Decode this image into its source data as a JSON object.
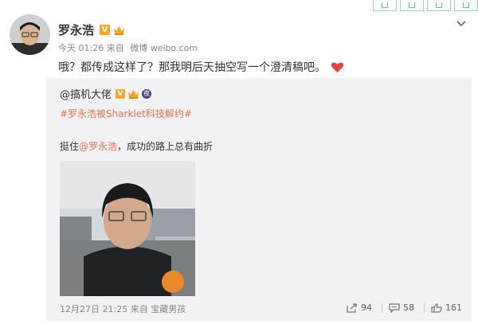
{
  "colors": {
    "accent": "#eb7350",
    "verified": "#f5a623",
    "heart": "#e0443a",
    "panel": "#f2f2f5"
  },
  "post": {
    "username": "罗永浩",
    "time": "今天 01:26",
    "source_prefix": "来自",
    "source": "微博 weibo.com",
    "text": "哦？都传成这样了？那我明后天抽空写一个澄清稿吧。"
  },
  "repost": {
    "username": "@搞机大佬",
    "hashtag": "#罗永浩被Sharklet科技解约#",
    "text_prefix": "挺住",
    "mention": "@罗永浩",
    "text_suffix": "，成功的路上总有曲折",
    "date": "12月27日 21:25",
    "source_prefix": "来自",
    "source": "宝藏男孩",
    "reposts": "94",
    "comments": "58",
    "likes": "161"
  },
  "icons": {
    "verified": "verified-v-icon",
    "member": "member-crown-icon",
    "night": "night-mode-icon",
    "menu": "chevron-down-icon",
    "heart": "heart-emoji-icon",
    "repost": "repost-icon",
    "comment": "comment-icon",
    "like": "like-icon"
  }
}
